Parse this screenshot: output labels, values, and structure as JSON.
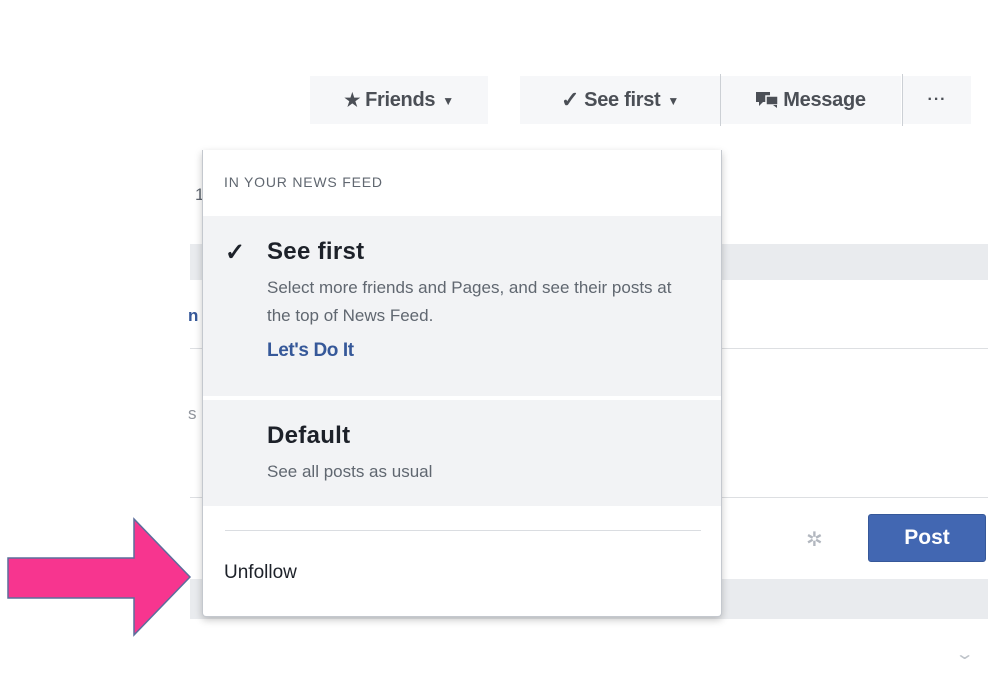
{
  "top_bar": {
    "friends": {
      "label": "Friends",
      "icon": "star-icon"
    },
    "see_first": {
      "label": "See first",
      "icon": "check-icon"
    },
    "message": {
      "label": "Message",
      "icon": "chat-icon"
    },
    "more": {
      "label": "···"
    }
  },
  "dropdown": {
    "header": "IN YOUR NEWS FEED",
    "options": [
      {
        "title": "See first",
        "selected": true,
        "description": "Select more friends and Pages, and see their posts at the top of News Feed.",
        "link": "Let's Do It"
      },
      {
        "title": "Default",
        "selected": false,
        "description": "See all posts as usual"
      }
    ],
    "unfollow": "Unfollow"
  },
  "composer": {
    "post_label": "Post"
  },
  "annotation": {
    "arrow_color": "#f7358f"
  },
  "colors": {
    "link": "#365899",
    "primary_button": "#4267b2",
    "page_background": "#e9ebee"
  }
}
